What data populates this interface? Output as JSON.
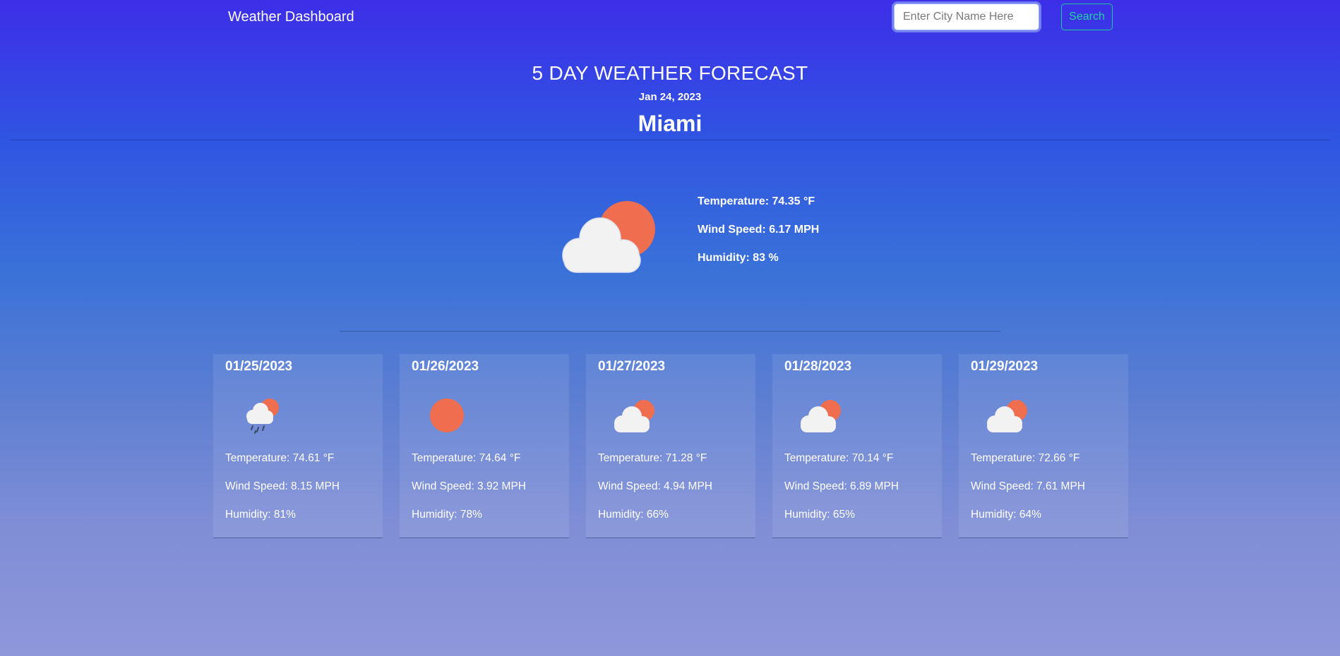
{
  "navbar": {
    "brand": "Weather Dashboard",
    "search_placeholder": "Enter City Name Here",
    "search_value": "",
    "search_button": "Search"
  },
  "header": {
    "title": "5 DAY WEATHER FORECAST",
    "date": "Jan 24, 2023",
    "city": "Miami"
  },
  "current": {
    "icon": "partly-cloudy-icon",
    "temperature": "Temperature: 74.35 °F",
    "wind": "Wind Speed: 6.17 MPH",
    "humidity": "Humidity: 83 %"
  },
  "forecast": [
    {
      "date": "01/25/2023",
      "icon": "rain-icon",
      "temperature": "Temperature: 74.61 °F",
      "wind": "Wind Speed: 8.15 MPH",
      "humidity": "Humidity: 81%"
    },
    {
      "date": "01/26/2023",
      "icon": "sun-icon",
      "temperature": "Temperature: 74.64 °F",
      "wind": "Wind Speed: 3.92 MPH",
      "humidity": "Humidity: 78%"
    },
    {
      "date": "01/27/2023",
      "icon": "partly-cloudy-icon",
      "temperature": "Temperature: 71.28 °F",
      "wind": "Wind Speed: 4.94 MPH",
      "humidity": "Humidity: 66%"
    },
    {
      "date": "01/28/2023",
      "icon": "partly-cloudy-icon",
      "temperature": "Temperature: 70.14 °F",
      "wind": "Wind Speed: 6.89 MPH",
      "humidity": "Humidity: 65%"
    },
    {
      "date": "01/29/2023",
      "icon": "partly-cloudy-icon",
      "temperature": "Temperature: 72.66 °F",
      "wind": "Wind Speed: 7.61 MPH",
      "humidity": "Humidity: 64%"
    }
  ],
  "colors": {
    "sun": "#ee6e4f",
    "cloud": "#f1f1f1",
    "search_accent": "#22d3a5"
  }
}
